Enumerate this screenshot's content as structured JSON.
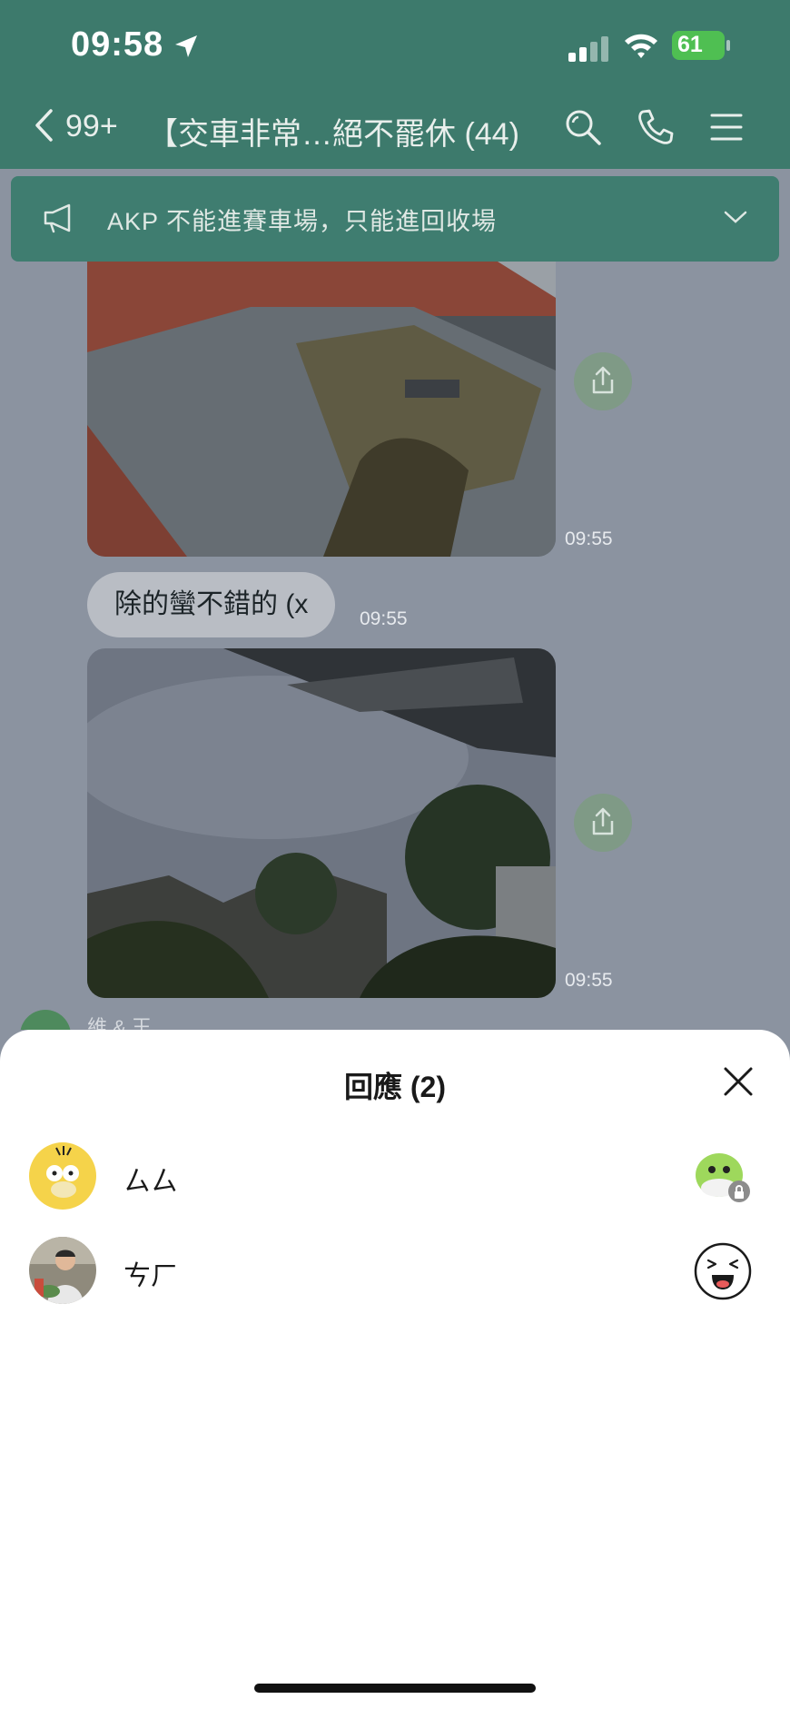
{
  "status_bar": {
    "time": "09:58",
    "battery": "61"
  },
  "header": {
    "back_count": "99+",
    "title": "【交車非常…絕不罷休 (44)",
    "icons": [
      "search-icon",
      "phone-icon",
      "menu-icon"
    ]
  },
  "announcement": {
    "text": "AKP 不能進賽車場，只能進回收場"
  },
  "chat": {
    "messages": [
      {
        "type": "image",
        "description_icon": "photo-car-windshield",
        "time": "09:55"
      },
      {
        "type": "text",
        "text": "除的蠻不錯的 (x",
        "time": "09:55"
      },
      {
        "type": "image",
        "description_icon": "photo-sky-trees",
        "time": "09:55"
      }
    ],
    "next_sender": "維 & 王"
  },
  "reactions_sheet": {
    "title": "回應 (2)",
    "rows": [
      {
        "name": "ㄙㄙ",
        "reaction_icon": "green-creature-sticker-icon"
      },
      {
        "name": "ㄘㄏ",
        "reaction_icon": "laughing-face-icon"
      }
    ]
  },
  "colors": {
    "header_bg": "#3d7a6c",
    "chat_bg": "#8b93a0",
    "sheet_bg": "#ffffff",
    "battery": "#4fbf52"
  }
}
